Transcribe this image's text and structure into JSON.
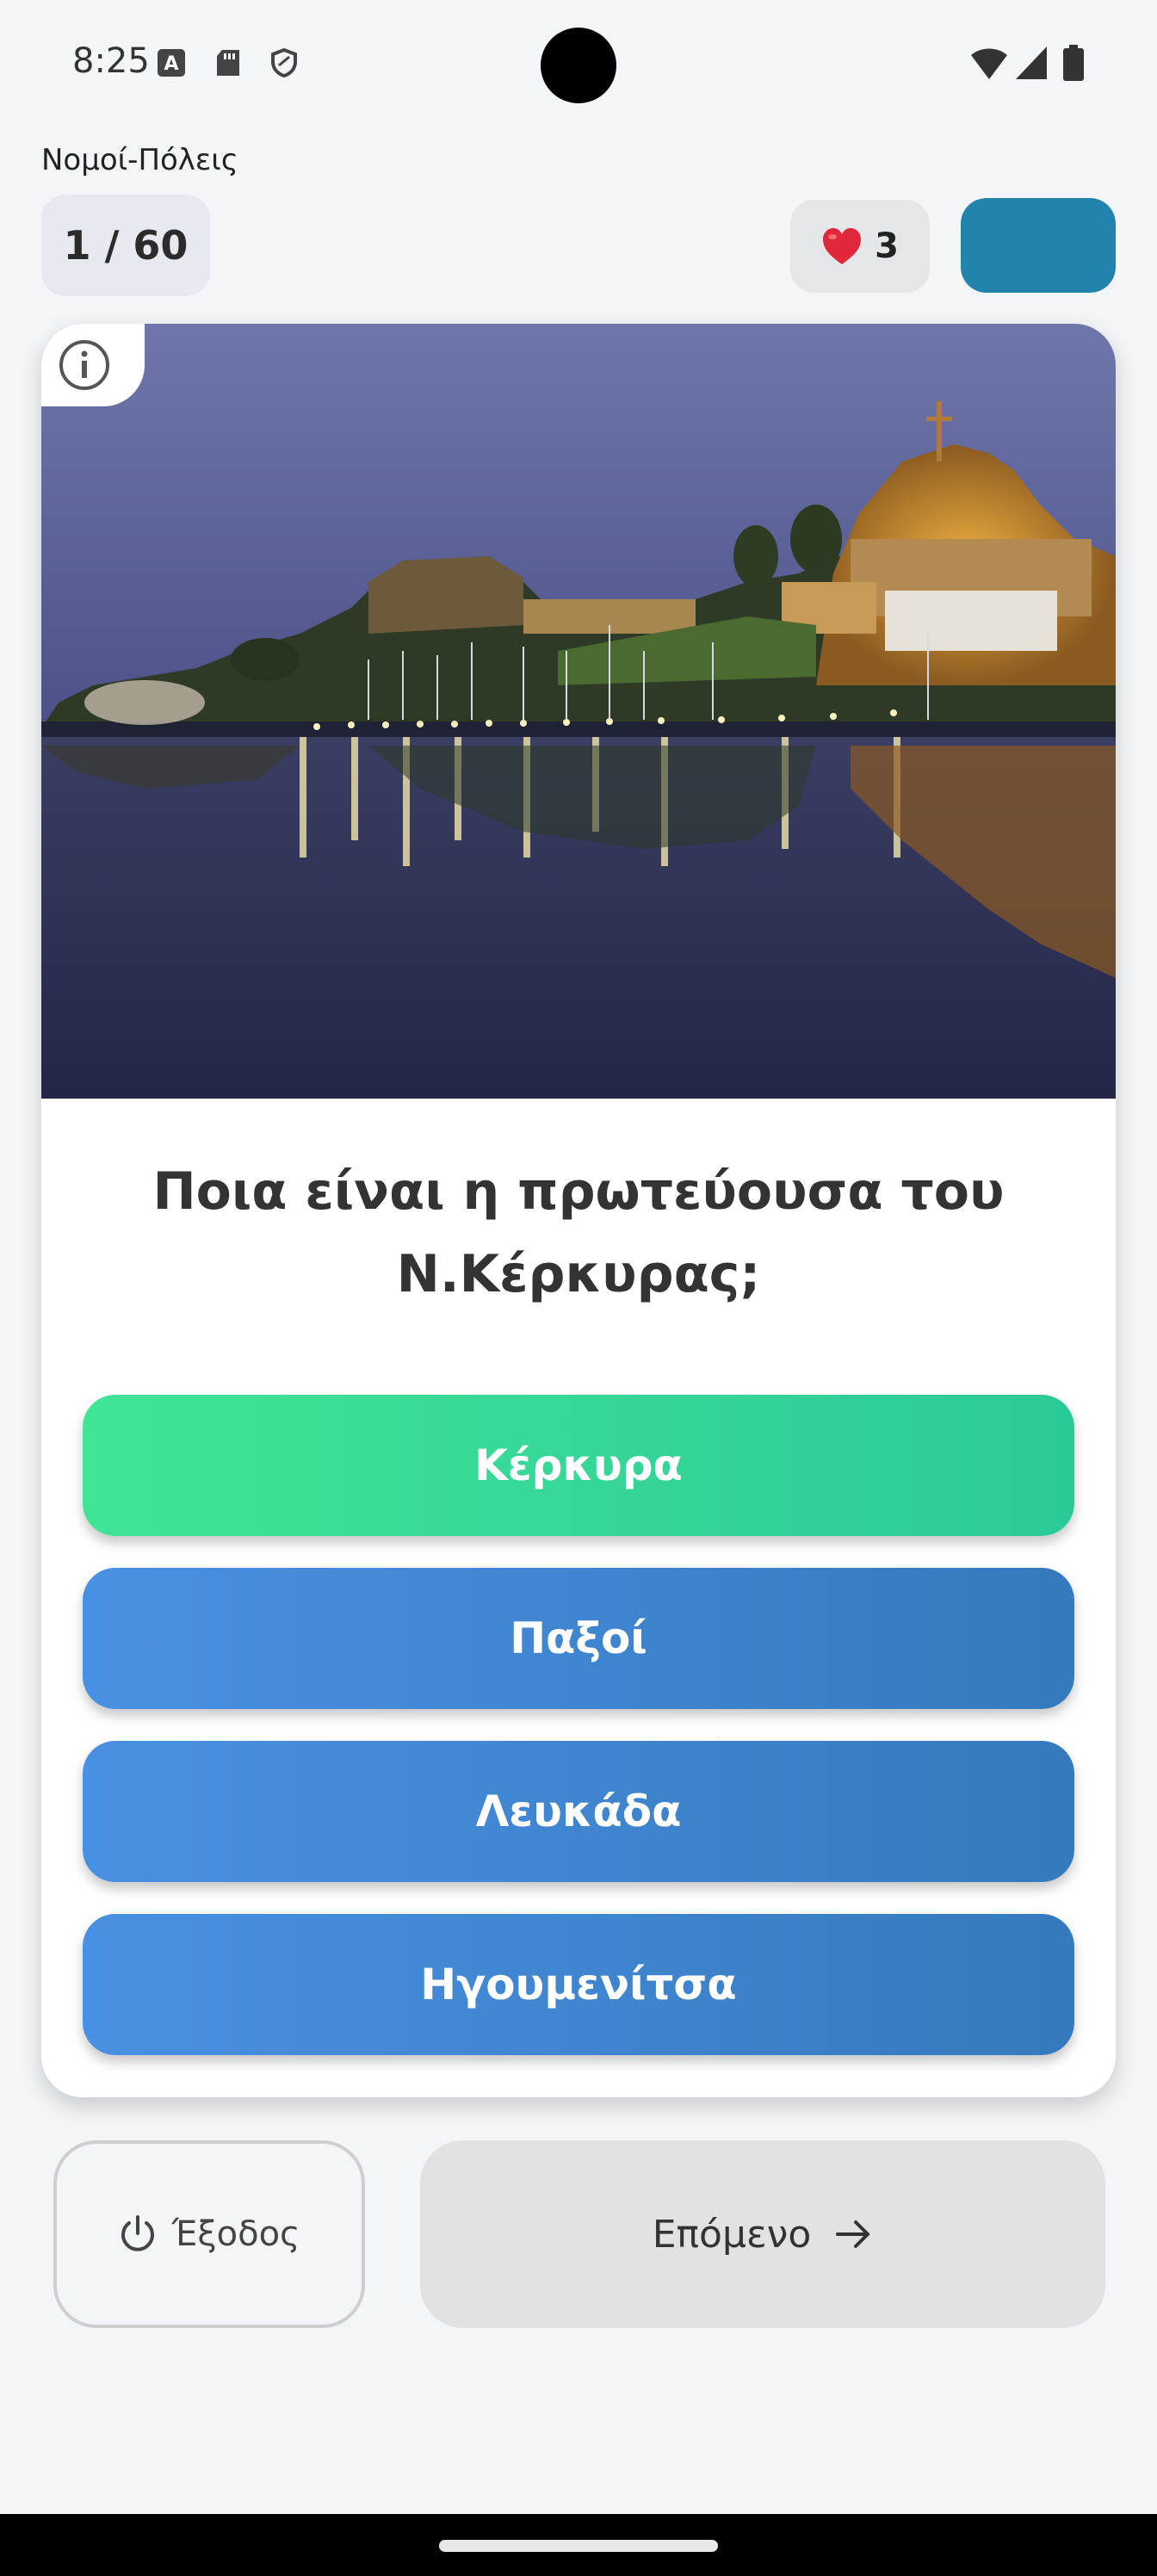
{
  "status_bar": {
    "time": "8:25",
    "left_icons": [
      "text-format-icon",
      "sd-card-icon",
      "shield-icon"
    ],
    "right_icons": [
      "wifi-icon",
      "cellular-signal-icon",
      "battery-icon"
    ]
  },
  "header": {
    "category": "Νομοί-Πόλεις",
    "progress": "1 / 60",
    "lives": "3",
    "lives_icon": "heart-icon",
    "action_color": "#2283ad"
  },
  "question_card": {
    "info_icon": "info-icon",
    "question": "Ποια είναι η πρωτεύουσα του Ν.Κέρκυρας;",
    "answers": [
      {
        "label": "Κέρκυρα",
        "state": "correct"
      },
      {
        "label": "Παξοί",
        "state": "default"
      },
      {
        "label": "Λευκάδα",
        "state": "default"
      },
      {
        "label": "Ηγουμενίτσα",
        "state": "default"
      }
    ],
    "colors": {
      "correct": "#41e495",
      "default": "#4a90e2"
    }
  },
  "footer": {
    "exit_label": "Έξοδος",
    "exit_icon": "power-icon",
    "next_label": "Επόμενο",
    "next_icon": "arrow-right-icon"
  }
}
